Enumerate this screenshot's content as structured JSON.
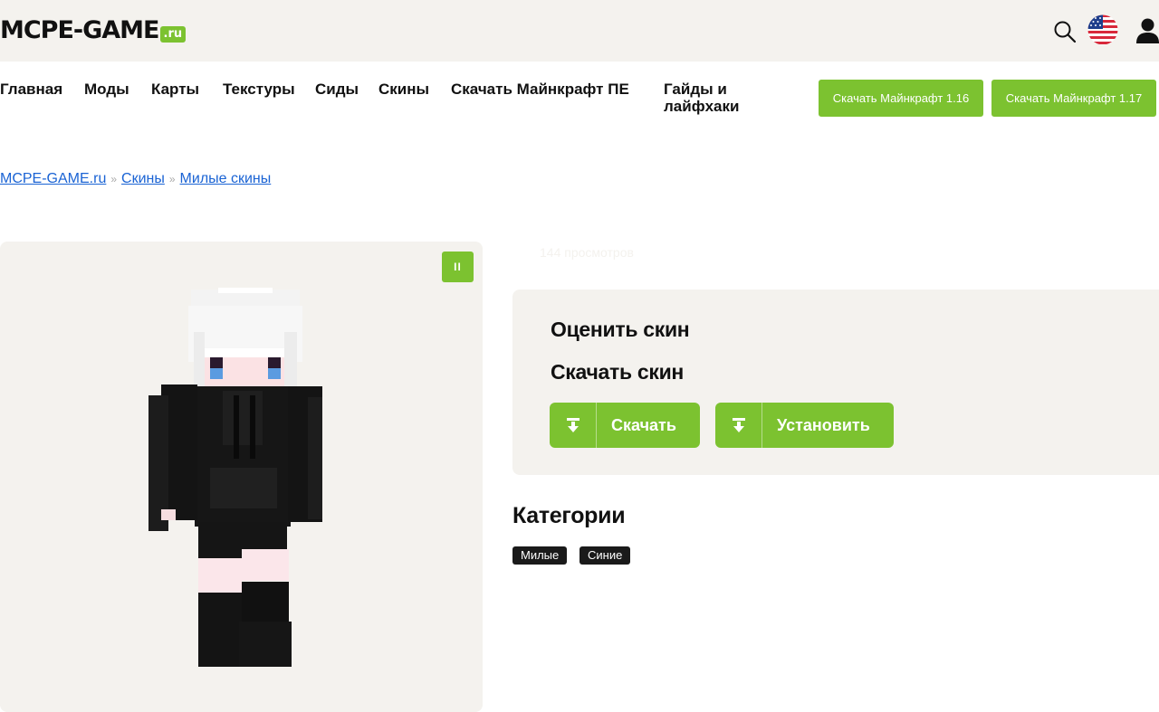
{
  "header": {
    "logo_main": "MCPE-GAME",
    "logo_suffix": ".ru",
    "icons": {
      "search": "search-icon",
      "language": "us-flag-icon",
      "user": "user-icon"
    }
  },
  "nav": {
    "items": [
      {
        "label": "Главная"
      },
      {
        "label": "Моды"
      },
      {
        "label": "Карты"
      },
      {
        "label": "Текстуры"
      },
      {
        "label": "Сиды"
      },
      {
        "label": "Скины"
      },
      {
        "label": "Скачать Майнкрафт ПЕ"
      },
      {
        "label": "Гайды и лайфхаки"
      }
    ],
    "download_buttons": [
      {
        "label": "Скачать Майнкрафт 1.16"
      },
      {
        "label": "Скачать Майнкрафт 1.17"
      }
    ]
  },
  "breadcrumb": {
    "items": [
      "MCPE-GAME.ru",
      "Скины",
      "Милые скины"
    ],
    "separator": "»"
  },
  "preview": {
    "pause_label": "II"
  },
  "views": "144 просмотров",
  "panel": {
    "rate_title": "Оценить скин",
    "download_title": "Скачать скин",
    "download_label": "Скачать",
    "install_label": "Установить"
  },
  "categories": {
    "title": "Категории",
    "tags": [
      "Милые",
      "Синие"
    ]
  },
  "colors": {
    "accent": "#7cc230",
    "panel_bg": "#f4f2ee",
    "link": "#1a63d4",
    "tag_bg": "#1a1a1a"
  }
}
